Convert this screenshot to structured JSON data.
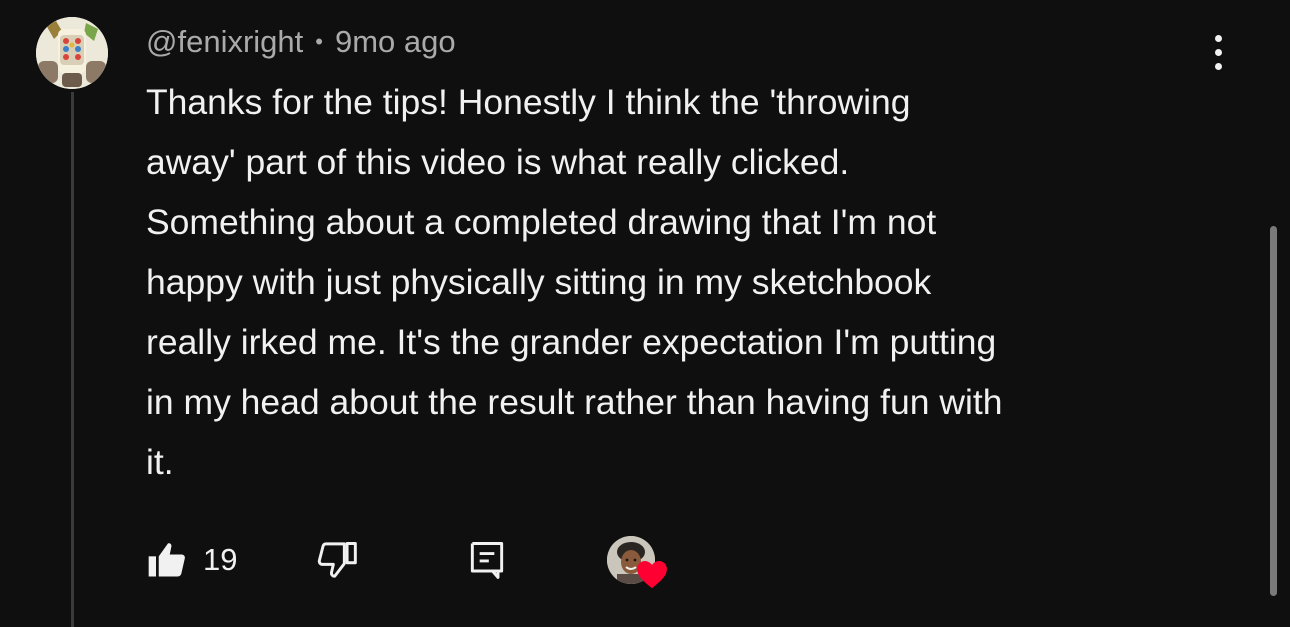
{
  "comment": {
    "author": "@fenixright",
    "separator": "•",
    "time": "9mo ago",
    "text_lines": [
      "Thanks for the tips! Honestly I think the 'throwing",
      "away' part of this video is what really clicked.",
      "Something about a completed drawing that I'm not",
      "happy with just physically sitting in my sketchbook",
      "really irked me. It's the grander expectation I'm putting",
      "in my head about the result rather than having fun with",
      "it."
    ],
    "like_count": "19"
  },
  "icons": {
    "menu": "more-vert-icon",
    "like": "thumbs-up-icon",
    "dislike": "thumbs-down-icon",
    "reply": "reply-comment-icon",
    "heart": "heart-icon"
  },
  "colors": {
    "background": "#0f0f0f",
    "text": "#f1f1f1",
    "secondary_text": "#aaaaaa",
    "heart": "#ff0033"
  }
}
